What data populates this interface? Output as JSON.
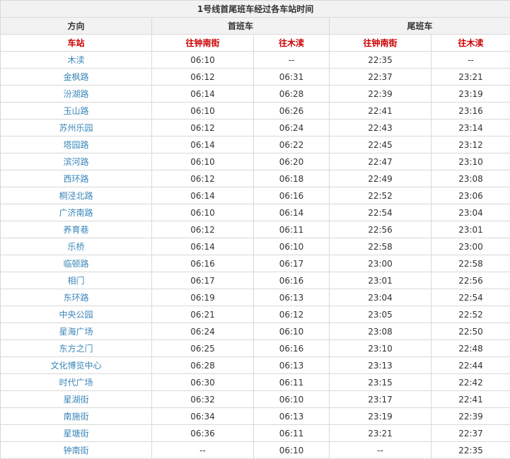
{
  "title": "1号线首尾班车经过各车站时间",
  "header": {
    "direction_label": "方向",
    "first_train_label": "首班车",
    "last_train_label": "尾班车",
    "station_label": "车站",
    "first_dir_a": "往钟南街",
    "first_dir_b": "往木渎",
    "last_dir_a": "往钟南街",
    "last_dir_b": "往木渎"
  },
  "colors": {
    "header_bg": "#f2f2f2",
    "subheader_text": "#cc0000",
    "station_text": "#3a86b8",
    "border": "#d9d9d9"
  },
  "rows": [
    {
      "station": "木渎",
      "first_a": "06:10",
      "first_b": "--",
      "last_a": "22:35",
      "last_b": "--"
    },
    {
      "station": "金枫路",
      "first_a": "06:12",
      "first_b": "06:31",
      "last_a": "22:37",
      "last_b": "23:21"
    },
    {
      "station": "汾湖路",
      "first_a": "06:14",
      "first_b": "06:28",
      "last_a": "22:39",
      "last_b": "23:19"
    },
    {
      "station": "玉山路",
      "first_a": "06:10",
      "first_b": "06:26",
      "last_a": "22:41",
      "last_b": "23:16"
    },
    {
      "station": "苏州乐园",
      "first_a": "06:12",
      "first_b": "06:24",
      "last_a": "22:43",
      "last_b": "23:14"
    },
    {
      "station": "塔园路",
      "first_a": "06:14",
      "first_b": "06:22",
      "last_a": "22:45",
      "last_b": "23:12"
    },
    {
      "station": "滨河路",
      "first_a": "06:10",
      "first_b": "06:20",
      "last_a": "22:47",
      "last_b": "23:10"
    },
    {
      "station": "西环路",
      "first_a": "06:12",
      "first_b": "06:18",
      "last_a": "22:49",
      "last_b": "23:08"
    },
    {
      "station": "桐泾北路",
      "first_a": "06:14",
      "first_b": "06:16",
      "last_a": "22:52",
      "last_b": "23:06"
    },
    {
      "station": "广济南路",
      "first_a": "06:10",
      "first_b": "06:14",
      "last_a": "22:54",
      "last_b": "23:04"
    },
    {
      "station": "养育巷",
      "first_a": "06:12",
      "first_b": "06:11",
      "last_a": "22:56",
      "last_b": "23:01"
    },
    {
      "station": "乐桥",
      "first_a": "06:14",
      "first_b": "06:10",
      "last_a": "22:58",
      "last_b": "23:00"
    },
    {
      "station": "临顿路",
      "first_a": "06:16",
      "first_b": "06:17",
      "last_a": "23:00",
      "last_b": "22:58"
    },
    {
      "station": "相门",
      "first_a": "06:17",
      "first_b": "06:16",
      "last_a": "23:01",
      "last_b": "22:56"
    },
    {
      "station": "东环路",
      "first_a": "06:19",
      "first_b": "06:13",
      "last_a": "23:04",
      "last_b": "22:54"
    },
    {
      "station": "中央公园",
      "first_a": "06:21",
      "first_b": "06:12",
      "last_a": "23:05",
      "last_b": "22:52"
    },
    {
      "station": "星海广场",
      "first_a": "06:24",
      "first_b": "06:10",
      "last_a": "23:08",
      "last_b": "22:50"
    },
    {
      "station": "东方之门",
      "first_a": "06:25",
      "first_b": "06:16",
      "last_a": "23:10",
      "last_b": "22:48"
    },
    {
      "station": "文化博览中心",
      "first_a": "06:28",
      "first_b": "06:13",
      "last_a": "23:13",
      "last_b": "22:44"
    },
    {
      "station": "时代广场",
      "first_a": "06:30",
      "first_b": "06:11",
      "last_a": "23:15",
      "last_b": "22:42"
    },
    {
      "station": "星湖街",
      "first_a": "06:32",
      "first_b": "06:10",
      "last_a": "23:17",
      "last_b": "22:41"
    },
    {
      "station": "南施街",
      "first_a": "06:34",
      "first_b": "06:13",
      "last_a": "23:19",
      "last_b": "22:39"
    },
    {
      "station": "星塘街",
      "first_a": "06:36",
      "first_b": "06:11",
      "last_a": "23:21",
      "last_b": "22:37"
    },
    {
      "station": "钟南街",
      "first_a": "--",
      "first_b": "06:10",
      "last_a": "--",
      "last_b": "22:35"
    }
  ]
}
